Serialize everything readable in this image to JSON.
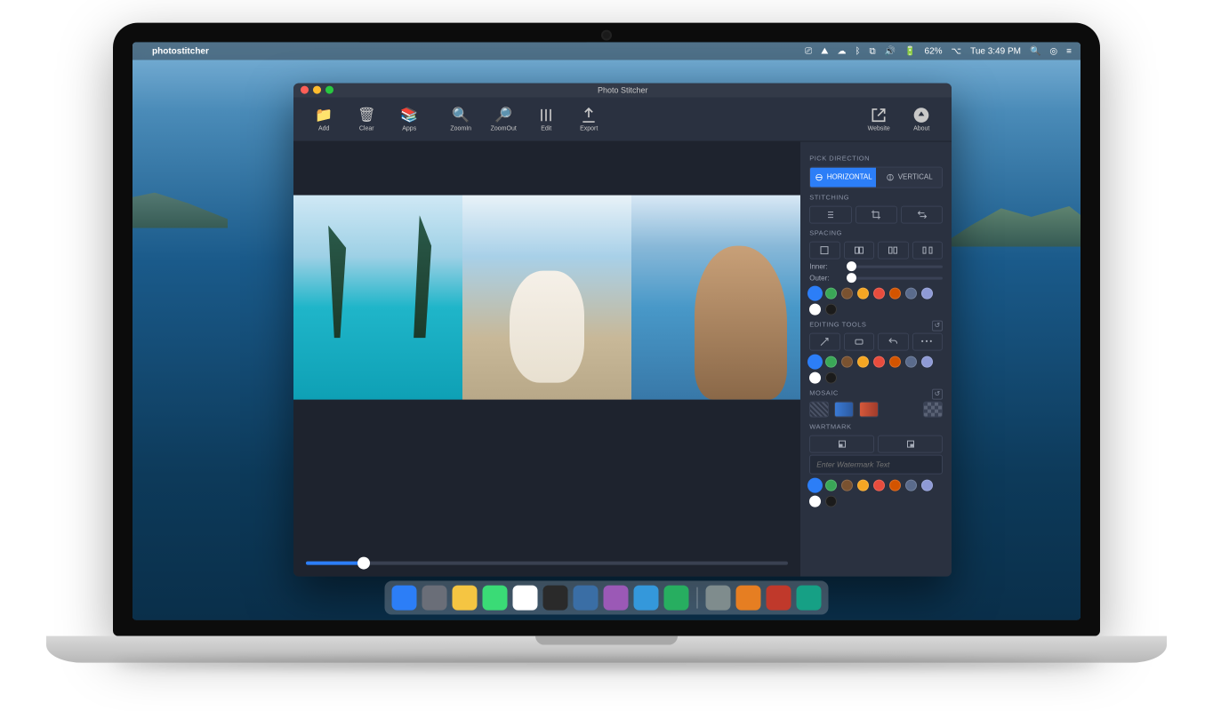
{
  "menubar": {
    "app_name": "photostitcher",
    "battery": "62%",
    "clock": "Tue 3:49 PM"
  },
  "window": {
    "title": "Photo Stitcher",
    "toolbar": {
      "add": "Add",
      "clear": "Clear",
      "apps": "Apps",
      "zoomin": "ZoomIn",
      "zoomout": "ZoomOut",
      "edit": "Edit",
      "export": "Export",
      "website": "Website",
      "about": "About"
    }
  },
  "sidebar": {
    "pick_direction": {
      "label": "PICK DIRECTION",
      "horizontal": "HORIZONTAL",
      "vertical": "VERTICAL",
      "selected": "horizontal"
    },
    "stitching": {
      "label": "STITCHING"
    },
    "spacing": {
      "label": "SPACING",
      "inner": "Inner:",
      "outer": "Outer:"
    },
    "editing_tools": {
      "label": "EDITING TOOLS"
    },
    "mosaic": {
      "label": "MOSAIC"
    },
    "watermark": {
      "label": "WARTMARK",
      "placeholder": "Enter Watermark Text"
    },
    "palette": [
      "#2c7ef7",
      "#3aa757",
      "#7a5230",
      "#f5a623",
      "#e84c3d",
      "#d35400",
      "#5a6b8c",
      "#8e9ad6",
      "#ffffff",
      "#1b1b1b"
    ]
  },
  "dock": {
    "apps": [
      "#2c7ef7",
      "#6a6e78",
      "#f5c542",
      "#3adb76",
      "#ffffff",
      "#2a2a2a",
      "#3a6ea5",
      "#9b59b6",
      "#3498db",
      "#27ae60"
    ],
    "apps2": [
      "#7f8c8d",
      "#e67e22",
      "#c0392b",
      "#16a085"
    ]
  }
}
